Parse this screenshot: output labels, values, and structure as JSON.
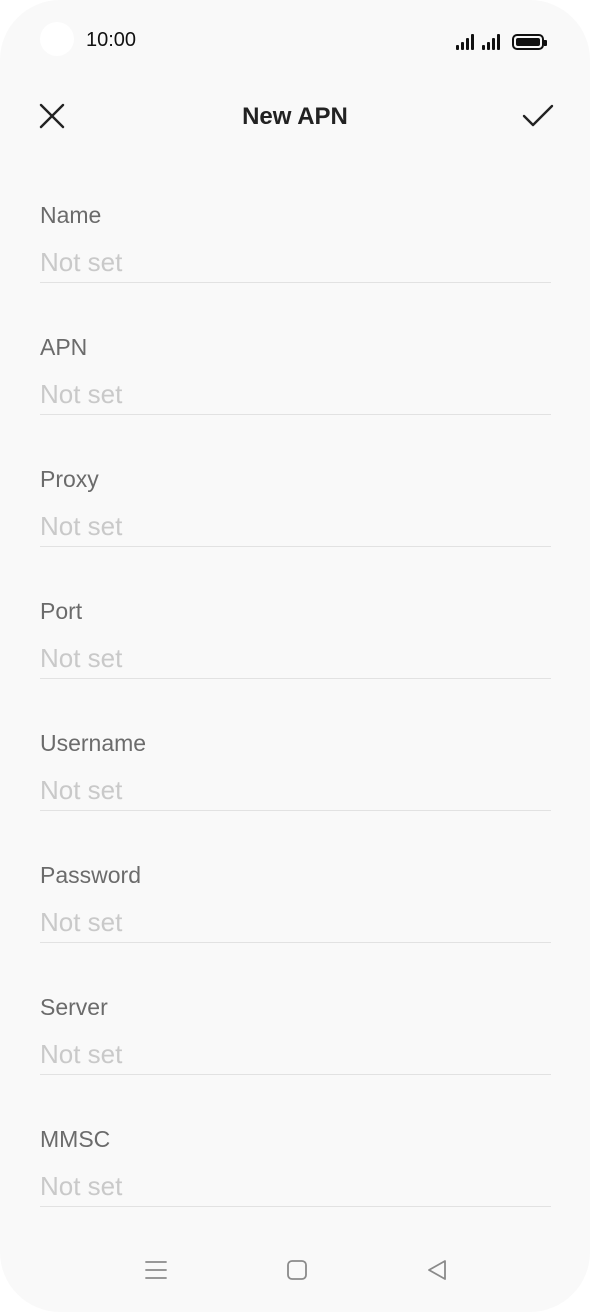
{
  "status_bar": {
    "time": "10:00"
  },
  "app_bar": {
    "title": "New APN",
    "close_icon": "close-icon",
    "confirm_icon": "check-icon"
  },
  "fields": [
    {
      "label": "Name",
      "value": "",
      "placeholder": "Not set"
    },
    {
      "label": "APN",
      "value": "",
      "placeholder": "Not set"
    },
    {
      "label": "Proxy",
      "value": "",
      "placeholder": "Not set"
    },
    {
      "label": "Port",
      "value": "",
      "placeholder": "Not set"
    },
    {
      "label": "Username",
      "value": "",
      "placeholder": "Not set"
    },
    {
      "label": "Password",
      "value": "",
      "placeholder": "Not set"
    },
    {
      "label": "Server",
      "value": "",
      "placeholder": "Not set"
    },
    {
      "label": "MMSC",
      "value": "",
      "placeholder": "Not set"
    }
  ],
  "nav_bar": {
    "menu_icon": "menu-icon",
    "home_icon": "home-icon",
    "back_icon": "back-icon"
  },
  "colors": {
    "background": "#f9f9f9",
    "label": "#6b6b6b",
    "placeholder": "#c9c9c9",
    "divider": "#e2e2e2",
    "title": "#222222"
  }
}
